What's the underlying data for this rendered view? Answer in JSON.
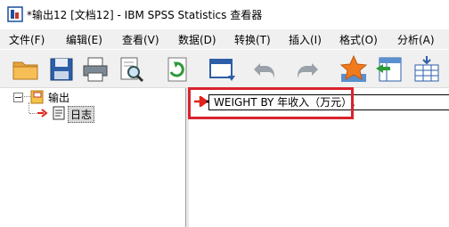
{
  "window": {
    "title": "*输出12 [文档12] - IBM SPSS Statistics 查看器"
  },
  "menu": [
    {
      "label": "文件(F)"
    },
    {
      "label": "编辑(E)"
    },
    {
      "label": "查看(V)"
    },
    {
      "label": "数据(D)"
    },
    {
      "label": "转换(T)"
    },
    {
      "label": "插入(I)"
    },
    {
      "label": "格式(O)"
    },
    {
      "label": "分析(A)"
    }
  ],
  "toolbar": {
    "icons": [
      "open-folder-icon",
      "save-icon",
      "print-icon",
      "print-preview-icon",
      "export-icon",
      "recall-dialog-icon",
      "undo-icon",
      "redo-icon",
      "goto-data-icon",
      "goto-variable-icon",
      "insert-table-icon"
    ]
  },
  "outline": {
    "root_label": "输出",
    "child_label": "日志"
  },
  "content": {
    "log_text": "WEIGHT BY 年收入（万元）."
  },
  "colors": {
    "highlight": "#d9232d",
    "arrow": "#e0231d"
  }
}
